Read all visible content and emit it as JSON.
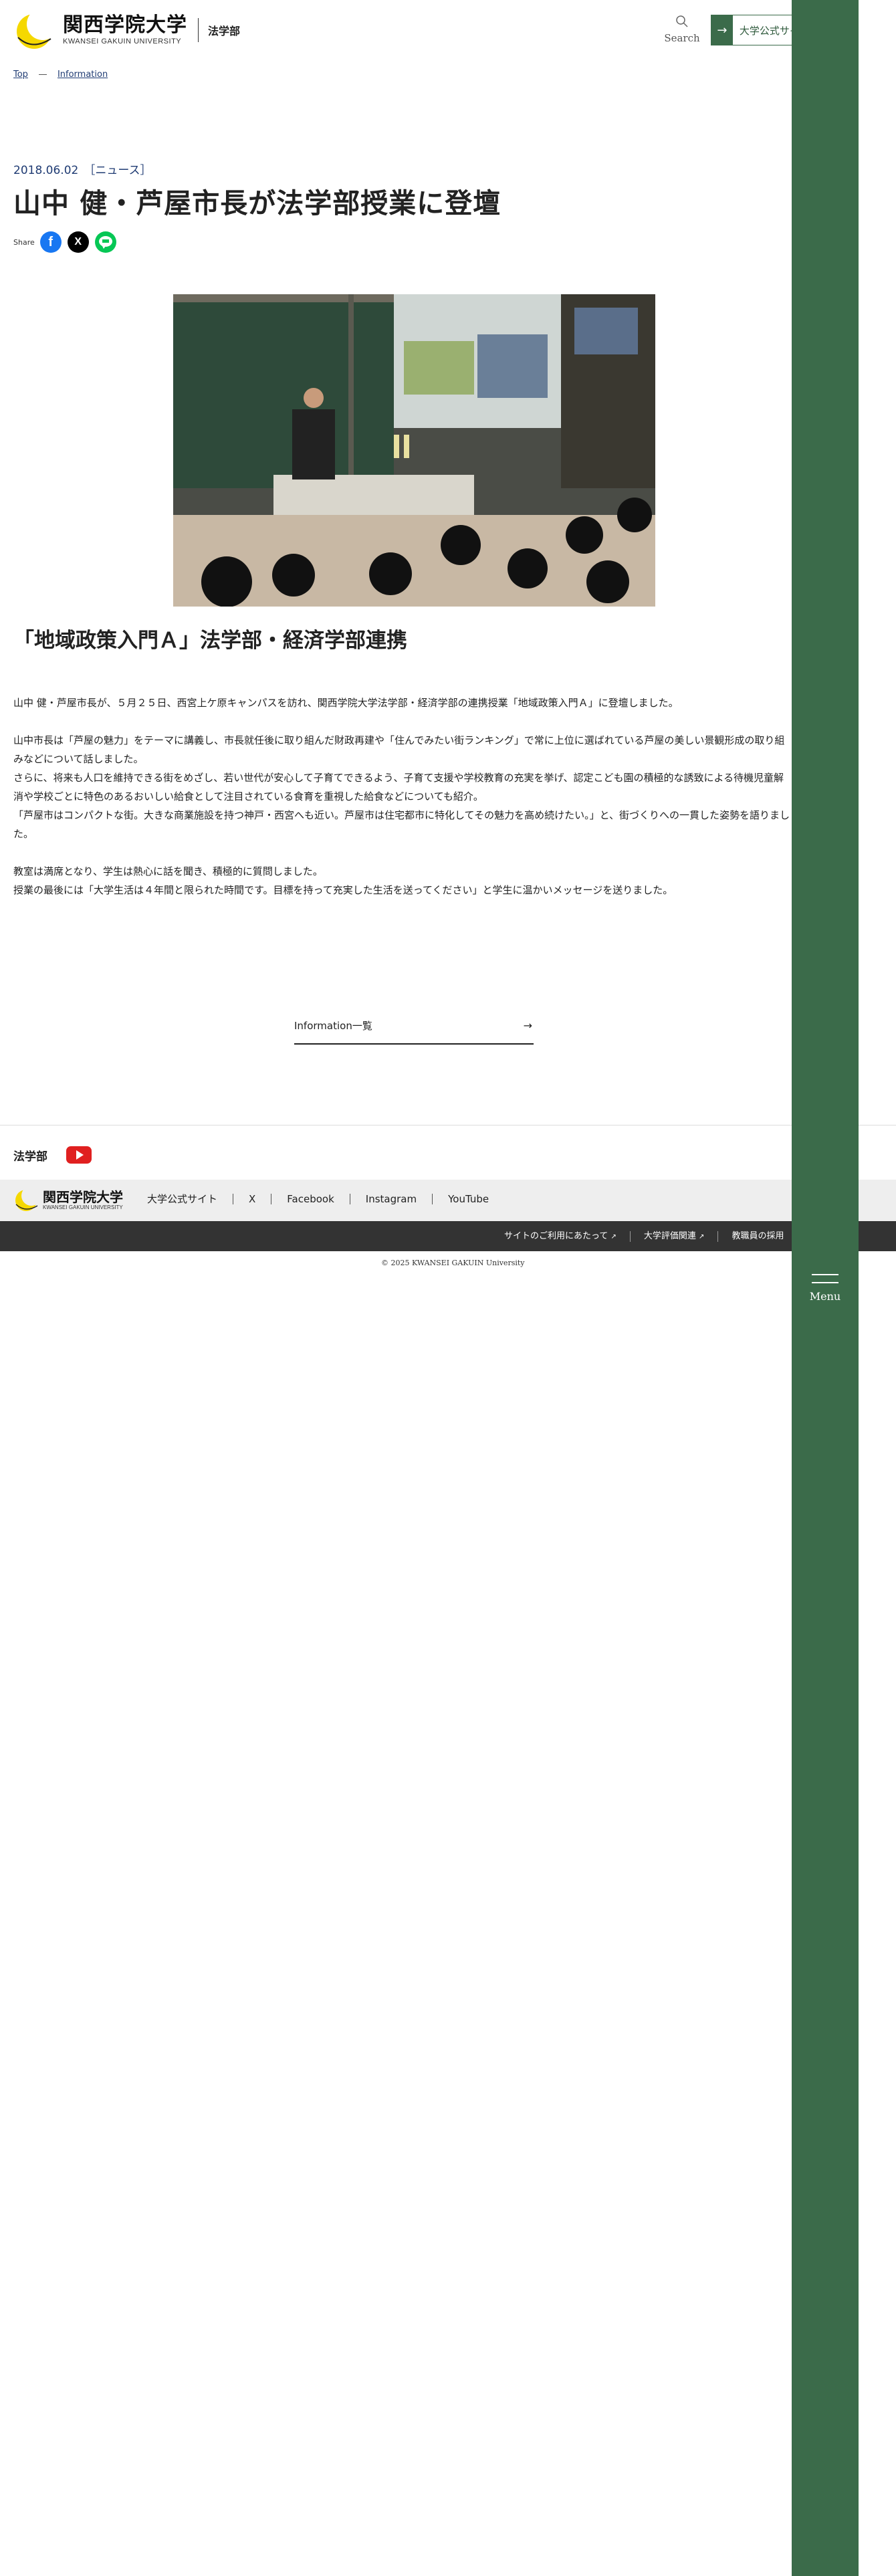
{
  "header": {
    "logo_jp": "関西学院大学",
    "logo_en": "KWANSEI GAKUIN UNIVERSITY",
    "dept": "法学部",
    "search_label": "Search",
    "univ_button": "大学公式サイト"
  },
  "breadcrumb": [
    "Top",
    "Information"
  ],
  "article": {
    "date": "2018.06.02",
    "category": "［ニュース］",
    "title": "山中 健・芦屋市長が法学部授業に登壇",
    "share_label": "Share",
    "share_icons": [
      "facebook-icon",
      "x-icon",
      "line-icon"
    ],
    "subtitle": "「地域政策入門Ａ」法学部・経済学部連携",
    "paragraphs": [
      [
        "山中 健・芦屋市長が、５月２５日、西宮上ケ原キャンパスを訪れ、関西学院大学法学部・経済学部の連携授業「地域政策入門Ａ」に登壇しました。"
      ],
      [
        "山中市長は「芦屋の魅力」をテーマに講義し、市長就任後に取り組んだ財政再建や「住んでみたい街ランキング」で常に上位に選ばれている芦屋の美しい景観形成の取り組みなどについて話しました。",
        "さらに、将来も人口を維持できる街をめざし、若い世代が安心して子育てできるよう、子育て支援や学校教育の充実を挙げ、認定こども園の積極的な誘致による待機児童解消や学校ごとに特色のあるおいしい給食として注目されている食育を重視した給食などについても紹介。",
        "「芦屋市はコンパクトな街。大きな商業施設を持つ神戸・西宮へも近い。芦屋市は住宅都市に特化してその魅力を高め続けたい。」と、街づくりへの一貫した姿勢を語りました。"
      ],
      [
        "教室は満席となり、学生は熱心に話を聞き、積極的に質問しました。",
        "授業の最後には「大学生活は４年間と限られた時間です。目標を持って充実した生活を送ってください」と学生に温かいメッセージを送りました。"
      ]
    ]
  },
  "info_link": "Information一覧",
  "footer": {
    "dept": "法学部",
    "logo_jp": "関西学院大学",
    "logo_en": "KWANSEI GAKUIN UNIVERSITY",
    "links": [
      "大学公式サイト",
      "X",
      "Facebook",
      "Instagram",
      "YouTube"
    ],
    "legal": [
      "サイトのご利用にあたって",
      "大学評価関連",
      "教職員の採用"
    ],
    "copyright": "© 2025 KWANSEI GAKUIN University"
  },
  "menu_label": "Menu",
  "colors": {
    "accent_green": "#3b6b4a",
    "link_blue": "#1f3b73",
    "dark_band": "#333333"
  }
}
